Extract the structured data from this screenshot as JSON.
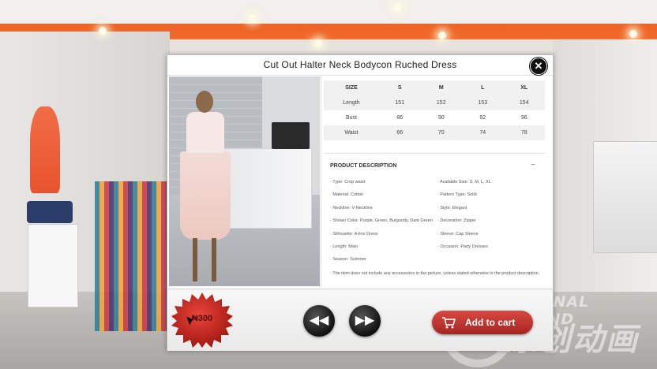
{
  "product": {
    "title": "Cut Out Halter Neck Bodycon Ruched Dress",
    "price": "₦300"
  },
  "size_chart": {
    "headers": [
      "SIZE",
      "S",
      "M",
      "L",
      "XL"
    ],
    "rows": [
      {
        "label": "Length",
        "values": [
          "151",
          "152",
          "153",
          "154"
        ]
      },
      {
        "label": "Bust",
        "values": [
          "86",
          "90",
          "92",
          "96"
        ]
      },
      {
        "label": "Waist",
        "values": [
          "66",
          "70",
          "74",
          "78"
        ]
      }
    ]
  },
  "description": {
    "title": "PRODUCT DESCRIPTION",
    "collapse_symbol": "−",
    "left": [
      "· Type: Crop waist",
      "· Material: Cotton",
      "· Neckline: V-Neckline",
      "· Shown Color: Purple, Green, Burgundy, Dark Green",
      "· Silhouette: A-line Dress",
      "· Length: Maxi",
      "· Season: Summer"
    ],
    "right": [
      "· Available Size: S, M, L, XL",
      "· Pattern Type: Solid",
      "· Style: Elegant",
      "· Decoration: Zipper",
      "· Sleeve: Cap Sleeve",
      "· Occasion: Party Dresses"
    ],
    "note": "· The item does not include any accessories in the picture, unless stated otherwise in the product description."
  },
  "controls": {
    "close_symbol": "✕",
    "prev_symbol": "◀◀",
    "next_symbol": "▶▶",
    "add_to_cart": "Add to cart"
  },
  "watermark": {
    "line1": "ORIGINAL EXPAND",
    "line2": "原创动画"
  },
  "colors": {
    "accent_red": "#b8302a",
    "ceiling_orange": "#e5571d"
  },
  "icons": [
    "close-icon",
    "rewind-icon",
    "fast-forward-icon",
    "cart-icon",
    "price-burst-badge"
  ]
}
